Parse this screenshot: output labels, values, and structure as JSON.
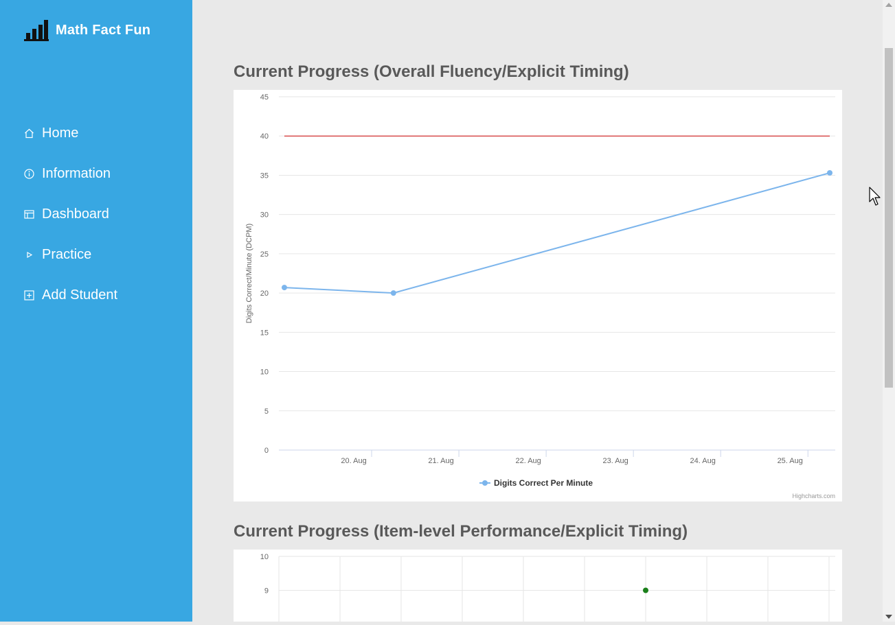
{
  "app": {
    "name": "Math Fact Fun",
    "logo_icon": "bar-chart-icon"
  },
  "sidebar": {
    "items": [
      {
        "label": "Home",
        "icon": "home-icon"
      },
      {
        "label": "Information",
        "icon": "info-icon"
      },
      {
        "label": "Dashboard",
        "icon": "table-icon"
      },
      {
        "label": "Practice",
        "icon": "play-icon"
      },
      {
        "label": "Add Student",
        "icon": "plus-square-icon"
      }
    ]
  },
  "main": {
    "section1_title": "Current Progress (Overall Fluency/Explicit Timing)",
    "section2_title": "Current Progress (Item-level Performance/Explicit Timing)",
    "credits": "Highcharts.com"
  },
  "colors": {
    "sidebar": "#38a7e2",
    "series": "#7cb5ec",
    "goal_line": "#cc0000",
    "point_green": "#1a7f1a",
    "point_orange": "#f7a35c"
  },
  "chart_data": [
    {
      "type": "line",
      "title": "",
      "ylabel": "Digits Correct/Minute (DCPM)",
      "xlabel": "",
      "ylim": [
        0,
        45
      ],
      "yticks": [
        0,
        5,
        10,
        15,
        20,
        25,
        30,
        35,
        40,
        45
      ],
      "xlim": [
        "2019-08-19",
        "2019-08-25"
      ],
      "xtick_labels": [
        "20. Aug",
        "21. Aug",
        "22. Aug",
        "23. Aug",
        "24. Aug",
        "25. Aug"
      ],
      "series": [
        {
          "name": "Digits Correct Per Minute",
          "x": [
            "2019-08-19",
            "2019-08-20",
            "2019-08-25"
          ],
          "values": [
            20.7,
            20,
            35.3
          ],
          "color": "#7cb5ec"
        }
      ],
      "plot_lines": [
        {
          "value": 40,
          "color": "#cc0000"
        }
      ],
      "legend": "bottom-center",
      "grid": true
    },
    {
      "type": "scatter",
      "title": "",
      "ylabel": "",
      "ylim": [
        8,
        10
      ],
      "yticks": [
        9,
        10
      ],
      "series": [
        {
          "name": "",
          "points": [
            {
              "x": 6,
              "y": 9
            }
          ],
          "color": "#1a7f1a"
        }
      ],
      "grid": true
    }
  ]
}
